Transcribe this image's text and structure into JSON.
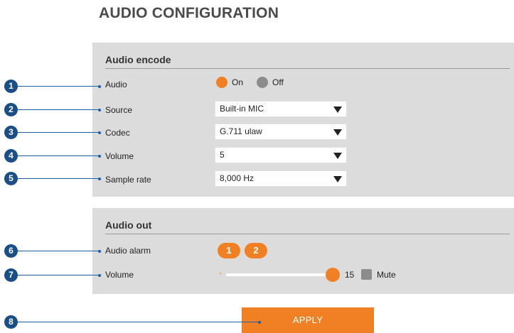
{
  "page_title": "AUDIO CONFIGURATION",
  "audio_encode": {
    "title": "Audio encode",
    "audio": {
      "label": "Audio",
      "on_label": "On",
      "off_label": "Off",
      "selected": "On"
    },
    "source": {
      "label": "Source",
      "value": "Built-in MIC"
    },
    "codec": {
      "label": "Codec",
      "value": "G.711 ulaw"
    },
    "volume": {
      "label": "Volume",
      "value": "5"
    },
    "sample_rate": {
      "label": "Sample rate",
      "value": "8,000 Hz"
    }
  },
  "audio_out": {
    "title": "Audio out",
    "alarm": {
      "label": "Audio alarm",
      "buttons": [
        "1",
        "2"
      ]
    },
    "volume": {
      "label": "Volume",
      "minus": "-",
      "value": "15",
      "max": 15,
      "mute_label": "Mute",
      "muted": false
    }
  },
  "apply_label": "APPLY",
  "callouts": [
    "1",
    "2",
    "3",
    "4",
    "5",
    "6",
    "7",
    "8"
  ],
  "colors": {
    "accent": "#f08023",
    "panel": "#dcdcdc",
    "callout": "#1a4f86",
    "radio_off": "#8c8c8c"
  }
}
